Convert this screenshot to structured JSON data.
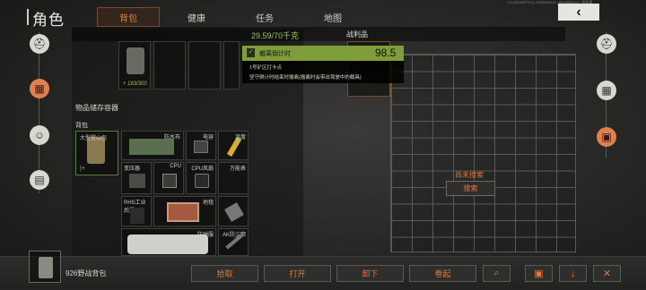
{
  "header": {
    "title": "角色",
    "tabs": [
      {
        "label": "背包",
        "active": true
      },
      {
        "label": "健康",
        "active": false
      },
      {
        "label": "任务",
        "active": false
      },
      {
        "label": "地图",
        "active": false
      }
    ],
    "build_info": "1.0.15(1152717) | 1033019421 | 8554652024 | 高质量"
  },
  "inventory": {
    "weight": "29.59/70千克",
    "backpack_durability": "183/300",
    "storage_title": "物品储存容器",
    "backpack_label": "背包",
    "items": [
      {
        "label": "大型登山包"
      },
      {
        "label": "防水布"
      },
      {
        "label": "电容"
      },
      {
        "label": "温度"
      },
      {
        "label": "变压器"
      },
      {
        "label": "显卡"
      },
      {
        "label": "CPU"
      },
      {
        "label": "CPU风扇"
      },
      {
        "label": "万能表"
      },
      {
        "label": "RHS工业后置"
      },
      {
        "label": "地毯"
      },
      {
        "label": "防弹服"
      },
      {
        "label": "AK防尘筒"
      }
    ]
  },
  "loot": {
    "title": "战利品",
    "status": "尚未搜索",
    "search_label": "搜索"
  },
  "popup": {
    "title": "撤离倒计时",
    "value": "98.5",
    "line1": "1号矿区打卡点",
    "line2": "坚守倒计时结束时撤离(撤离时会带出驾驶中的载具)"
  },
  "bottom": {
    "current_item": "926野战背包",
    "buttons": [
      "拾取",
      "打开",
      "卸下",
      "卷起"
    ]
  },
  "colors": {
    "accent": "#e07a3a",
    "popup_green": "#7f9d3a"
  }
}
